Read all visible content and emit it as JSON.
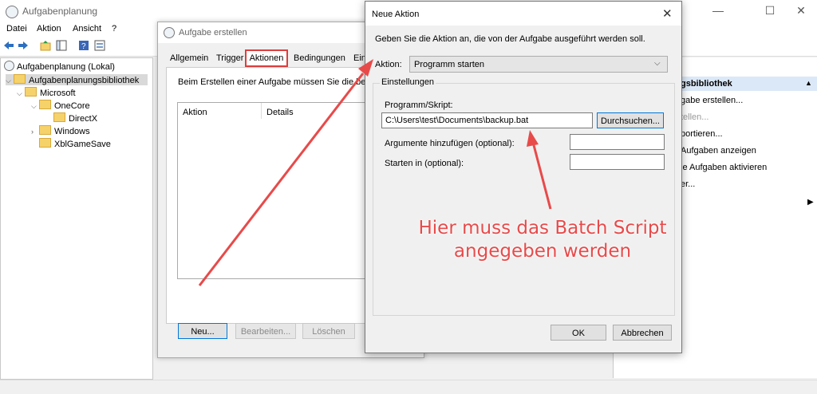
{
  "main": {
    "title": "Aufgabenplanung",
    "menu": [
      "Datei",
      "Aktion",
      "Ansicht",
      "?"
    ],
    "tree": {
      "root": "Aufgabenplanung (Lokal)",
      "library": "Aufgabenplanungsbibliothek",
      "microsoft": "Microsoft",
      "onecore": "OneCore",
      "directx": "DirectX",
      "windows": "Windows",
      "xblgamesave": "XblGameSave"
    },
    "actions_pane": {
      "header": "gsbibliothek",
      "items": [
        "gabe erstellen...",
        "tellen...",
        "portieren...",
        "Aufgaben anzeigen",
        "le Aufgaben aktivieren",
        "er..."
      ]
    }
  },
  "task_dialog": {
    "title": "Aufgabe erstellen",
    "tabs": [
      "Allgemein",
      "Trigger",
      "Aktionen",
      "Bedingungen",
      "Ein"
    ],
    "description": "Beim Erstellen einer Aufgabe müssen Sie die bei",
    "columns": [
      "Aktion",
      "Details"
    ],
    "buttons": {
      "new": "Neu...",
      "edit": "Bearbeiten...",
      "delete": "Löschen"
    }
  },
  "action_dialog": {
    "title": "Neue Aktion",
    "description": "Geben Sie die Aktion an, die von der Aufgabe ausgeführt werden soll.",
    "action_label": "Aktion:",
    "action_value": "Programm starten",
    "group_label": "Einstellungen",
    "program_label": "Programm/Skript:",
    "program_value": "C:\\Users\\test\\Documents\\backup.bat",
    "browse_label": "Durchsuchen...",
    "args_label": "Argumente hinzufügen (optional):",
    "args_value": "",
    "start_label": "Starten in (optional):",
    "start_value": "",
    "ok_label": "OK",
    "cancel_label": "Abbrechen"
  },
  "annotation": {
    "line1": "Hier muss das Batch Script",
    "line2": "angegeben werden",
    "color": "#e84a4a"
  }
}
